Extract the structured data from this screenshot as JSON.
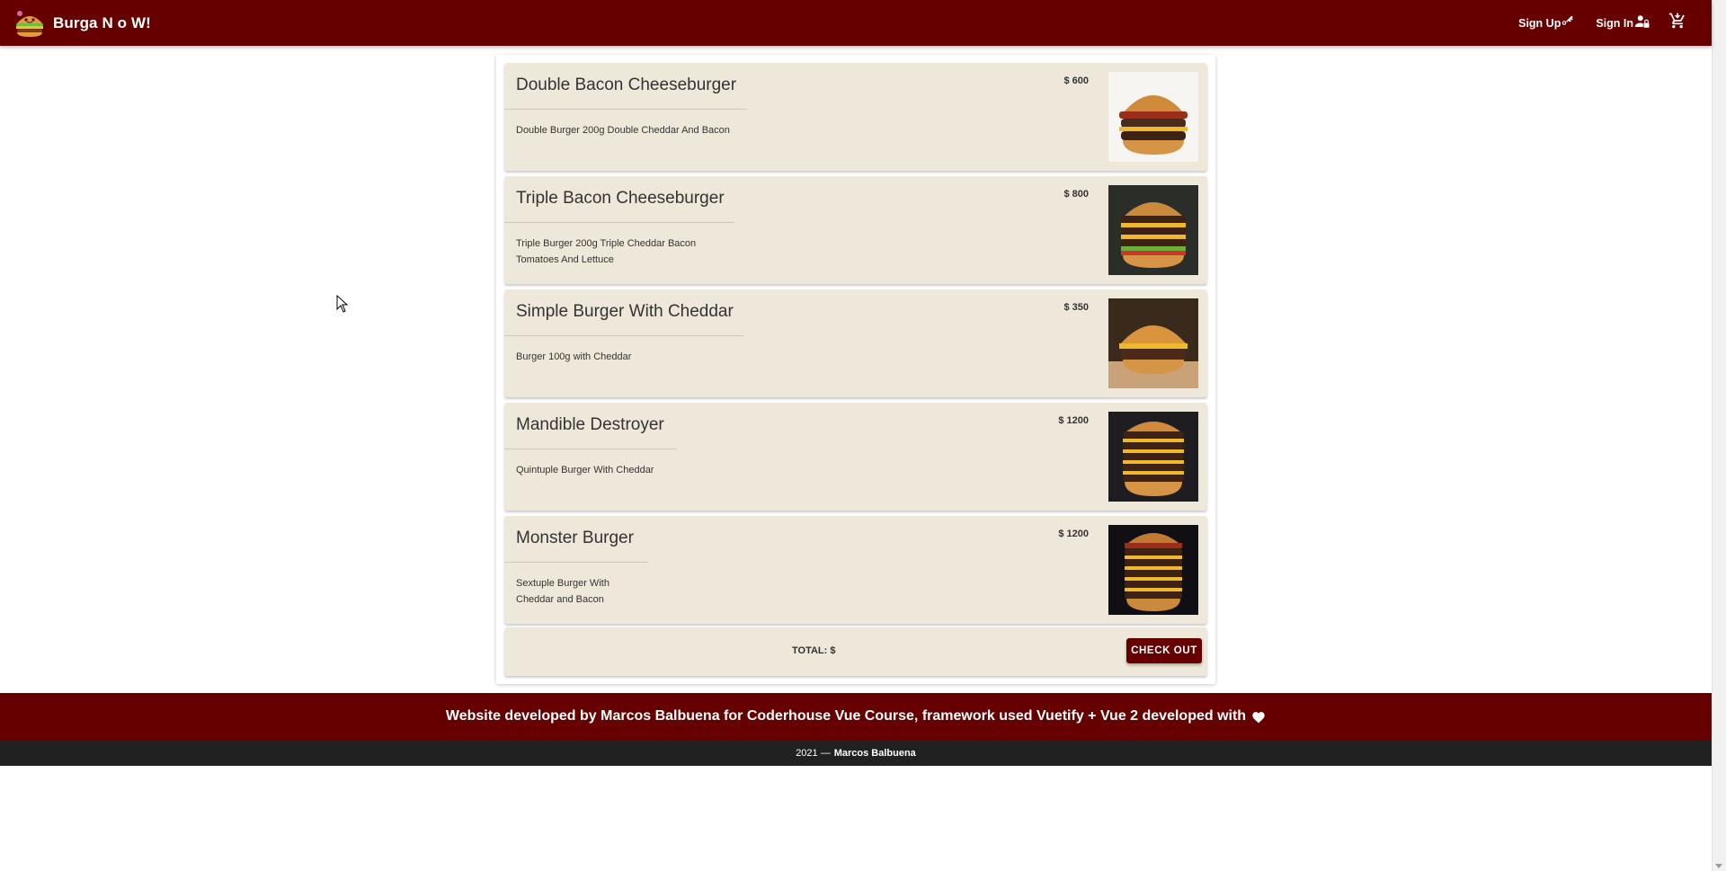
{
  "header": {
    "brand": "Burga N o W!",
    "nav": [
      {
        "label": "Sign Up",
        "icon": "account-key-icon"
      },
      {
        "label": "Sign In",
        "icon": "account-lock-icon"
      }
    ],
    "cart_icon": "cart-icon"
  },
  "cart": {
    "items": [
      {
        "name": "Double Bacon Cheeseburger",
        "description": "Double Burger 200g Double Cheddar And Bacon",
        "price": "$ 600"
      },
      {
        "name": "Triple Bacon Cheeseburger",
        "description": "Triple Burger 200g Triple Cheddar Bacon Tomatoes And Lettuce",
        "price": "$ 800"
      },
      {
        "name": "Simple Burger With Cheddar",
        "description": "Burger 100g with Cheddar",
        "price": "$ 350"
      },
      {
        "name": "Mandible Destroyer",
        "description": "Quintuple Burger With Cheddar",
        "price": "$ 1200"
      },
      {
        "name": "Monster Burger",
        "description": "Sextuple Burger With Cheddar and Bacon",
        "price": "$ 1200"
      }
    ],
    "total_label": "TOTAL: $",
    "checkout_label": "CHECK OUT"
  },
  "footer": {
    "credit": "Website developed by Marcos Balbuena for Coderhouse Vue Course, framework used Vuetify + Vue 2 developed with",
    "year": "2021 —",
    "author": "Marcos Balbuena"
  },
  "colors": {
    "primary": "#660000",
    "card": "#ede8da",
    "footer_dark": "#212121"
  }
}
